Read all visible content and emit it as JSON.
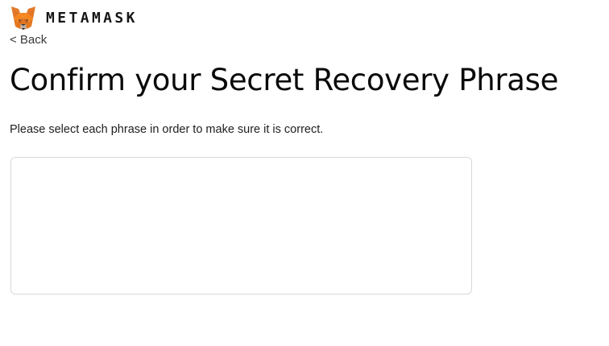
{
  "header": {
    "logo_icon": "metamask-fox-icon",
    "wordmark": "METAMASK"
  },
  "nav": {
    "back_label": "< Back"
  },
  "main": {
    "title": "Confirm your Secret Recovery Phrase",
    "instructions": "Please select each phrase in order to make sure it is correct.",
    "selected_words": []
  },
  "colors": {
    "fox_orange": "#e2761b",
    "fox_light": "#f6851b",
    "fox_dark": "#763d16",
    "border": "#d6d9dc",
    "text": "#24272a"
  }
}
